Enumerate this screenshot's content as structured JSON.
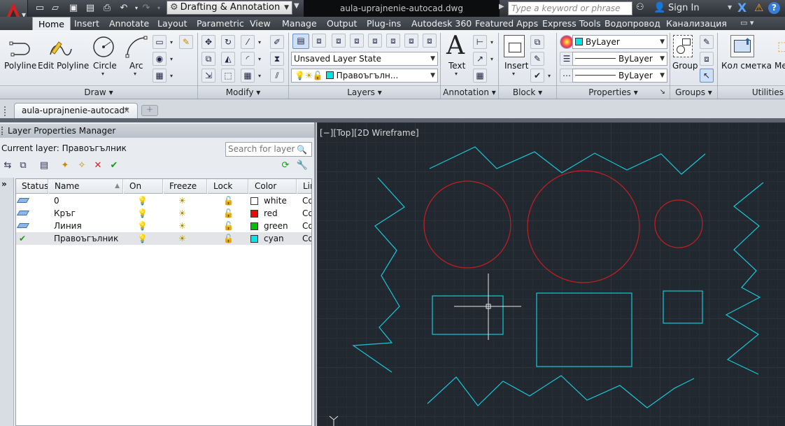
{
  "titlebar": {
    "workspace": "Drafting & Annotation",
    "document_title": "aula-uprajnenie-autocad.dwg",
    "search_placeholder": "Type a keyword or phrase",
    "sign_in": "Sign In"
  },
  "ribbon_tabs": [
    "Home",
    "Insert",
    "Annotate",
    "Layout",
    "Parametric",
    "View",
    "Manage",
    "Output",
    "Plug-ins",
    "Autodesk 360",
    "Featured Apps",
    "Express Tools",
    "Водопровод",
    "Канализация"
  ],
  "ribbon": {
    "draw": {
      "title": "Draw",
      "polyline": "Polyline",
      "edit_polyline": "Edit Polyline",
      "circle": "Circle",
      "arc": "Arc"
    },
    "modify": {
      "title": "Modify"
    },
    "layers": {
      "title": "Layers",
      "layer_state": "Unsaved Layer State",
      "current_layer": "Правоъгълн..."
    },
    "annotation": {
      "title": "Annotation",
      "text": "Text"
    },
    "block": {
      "title": "Block",
      "insert": "Insert"
    },
    "properties": {
      "title": "Properties",
      "color": "ByLayer",
      "linetype": "ByLayer",
      "lineweight": "ByLayer"
    },
    "groups": {
      "title": "Groups",
      "group": "Group"
    },
    "extra": {
      "kol_smetka": "Кол сметка",
      "me": "Me",
      "utilities": "Utilities"
    }
  },
  "doc_tab": {
    "label": "aula-uprajnenie-autocad*",
    "close": "✕"
  },
  "layer_manager": {
    "title": "Layer Properties Manager",
    "current_layer_label": "Current layer: Правоъгълник",
    "search_placeholder": "Search for layer",
    "columns": [
      "Status",
      "Name",
      "On",
      "Freeze",
      "Lock",
      "Color",
      "Linetype"
    ],
    "rows": [
      {
        "name": "0",
        "color_name": "white",
        "color": "#ffffff",
        "linetype": "Continuous",
        "current": false
      },
      {
        "name": "Кръг",
        "color_name": "red",
        "color": "#ff0000",
        "linetype": "Continuous",
        "current": false
      },
      {
        "name": "Линия",
        "color_name": "green",
        "color": "#00c000",
        "linetype": "Continuous",
        "current": false
      },
      {
        "name": "Правоъгълник",
        "color_name": "cyan",
        "color": "#00e5e5",
        "linetype": "Continuous",
        "current": true
      }
    ]
  },
  "viewport": {
    "label": "[−][Top][2D Wireframe]"
  },
  "colors": {
    "canvas": "#212830",
    "circle": "#c81e1e",
    "line": "#19c8d8",
    "accent": "#d02020"
  }
}
